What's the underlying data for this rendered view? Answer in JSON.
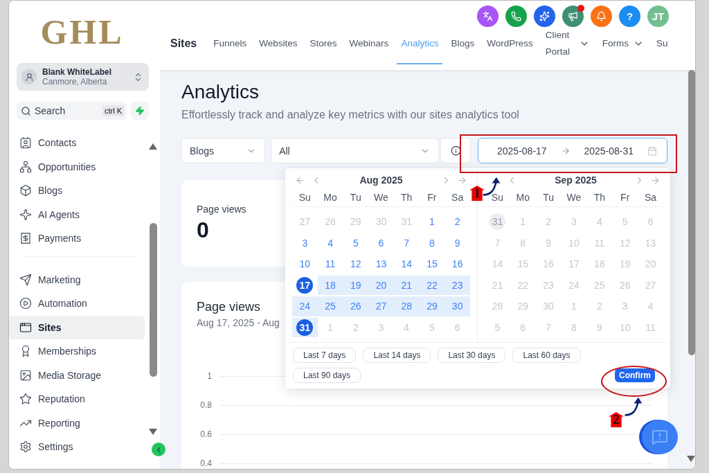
{
  "sidebar": {
    "logo": "GHL",
    "account": {
      "name": "Blank WhiteLabel",
      "location": "Canmore, Alberta"
    },
    "search": {
      "placeholder": "Search",
      "shortcut": "ctrl K"
    },
    "nav_groups": [
      [
        {
          "label": "Contacts",
          "selected": false
        },
        {
          "label": "Opportunities",
          "selected": false
        },
        {
          "label": "Blogs",
          "selected": false
        },
        {
          "label": "AI Agents",
          "selected": false
        },
        {
          "label": "Payments",
          "selected": false
        }
      ],
      [
        {
          "label": "Marketing",
          "selected": false
        },
        {
          "label": "Automation",
          "selected": false
        },
        {
          "label": "Sites",
          "selected": true
        },
        {
          "label": "Memberships",
          "selected": false
        },
        {
          "label": "Media Storage",
          "selected": false
        },
        {
          "label": "Reputation",
          "selected": false
        },
        {
          "label": "Reporting",
          "selected": false
        }
      ],
      [
        {
          "label": "Settings",
          "selected": false
        }
      ]
    ]
  },
  "header": {
    "actions": [
      {
        "kind": "translate",
        "color": "#a855f7",
        "badge": false
      },
      {
        "kind": "phone",
        "color": "#16a34a",
        "badge": false
      },
      {
        "kind": "sparkles",
        "color": "#2563eb",
        "badge": false
      },
      {
        "kind": "megaphone",
        "color": "#3f8f72",
        "badge": true
      },
      {
        "kind": "bell",
        "color": "#f97316",
        "badge": false
      },
      {
        "kind": "help",
        "label": "?",
        "color": "#1d8cf0",
        "badge": false
      },
      {
        "kind": "avatar",
        "label": "JT",
        "color": "#74bf92",
        "badge": false
      }
    ],
    "section": "Sites",
    "tabs": [
      {
        "label": "Funnels",
        "selected": false,
        "dropdown": false
      },
      {
        "label": "Websites",
        "selected": false,
        "dropdown": false
      },
      {
        "label": "Stores",
        "selected": false,
        "dropdown": false
      },
      {
        "label": "Webinars",
        "selected": false,
        "dropdown": false
      },
      {
        "label": "Analytics",
        "selected": true,
        "dropdown": false
      },
      {
        "label": "Blogs",
        "selected": false,
        "dropdown": false
      },
      {
        "label": "WordPress",
        "selected": false,
        "dropdown": false
      },
      {
        "label": "Client Portal",
        "selected": false,
        "dropdown": true
      },
      {
        "label": "Forms",
        "selected": false,
        "dropdown": true
      },
      {
        "label": "Su",
        "selected": false,
        "dropdown": false
      }
    ]
  },
  "page": {
    "title": "Analytics",
    "subtitle": "Effortlessly track and analyze key metrics with our sites analytics tool"
  },
  "filters": {
    "type_select": "Blogs",
    "item_select": "All",
    "date_start": "2025-08-17",
    "date_end": "2025-08-31"
  },
  "stat_card": {
    "label": "Page views",
    "value": "0"
  },
  "chart_card": {
    "title": "Page views",
    "subtitle": "Aug 17, 2025 - Aug",
    "y_ticks": [
      "1",
      "0.8",
      "0.6",
      "0.4"
    ]
  },
  "date_picker": {
    "months": [
      {
        "title": "Aug 2025",
        "weekdays": [
          "Su",
          "Mo",
          "Tu",
          "We",
          "Th",
          "Fr",
          "Sa"
        ],
        "weeks": [
          [
            {
              "label": "27",
              "kind": "other"
            },
            {
              "label": "28",
              "kind": "other"
            },
            {
              "label": "29",
              "kind": "other"
            },
            {
              "label": "30",
              "kind": "other"
            },
            {
              "label": "31",
              "kind": "other"
            },
            {
              "label": "1",
              "kind": "day"
            },
            {
              "label": "2",
              "kind": "day"
            }
          ],
          [
            {
              "label": "3",
              "kind": "day"
            },
            {
              "label": "4",
              "kind": "day"
            },
            {
              "label": "5",
              "kind": "day"
            },
            {
              "label": "6",
              "kind": "day"
            },
            {
              "label": "7",
              "kind": "day"
            },
            {
              "label": "8",
              "kind": "day"
            },
            {
              "label": "9",
              "kind": "day"
            }
          ],
          [
            {
              "label": "10",
              "kind": "day"
            },
            {
              "label": "11",
              "kind": "day"
            },
            {
              "label": "12",
              "kind": "day"
            },
            {
              "label": "13",
              "kind": "day"
            },
            {
              "label": "14",
              "kind": "day"
            },
            {
              "label": "15",
              "kind": "day"
            },
            {
              "label": "16",
              "kind": "day"
            }
          ],
          [
            {
              "label": "17",
              "kind": "endpoint"
            },
            {
              "label": "18",
              "kind": "range"
            },
            {
              "label": "19",
              "kind": "range"
            },
            {
              "label": "20",
              "kind": "range"
            },
            {
              "label": "21",
              "kind": "range"
            },
            {
              "label": "22",
              "kind": "range"
            },
            {
              "label": "23",
              "kind": "range"
            }
          ],
          [
            {
              "label": "24",
              "kind": "range"
            },
            {
              "label": "25",
              "kind": "range"
            },
            {
              "label": "26",
              "kind": "range"
            },
            {
              "label": "27",
              "kind": "range"
            },
            {
              "label": "28",
              "kind": "range"
            },
            {
              "label": "29",
              "kind": "range"
            },
            {
              "label": "30",
              "kind": "range"
            }
          ],
          [
            {
              "label": "31",
              "kind": "endpoint"
            },
            {
              "label": "1",
              "kind": "other"
            },
            {
              "label": "2",
              "kind": "other"
            },
            {
              "label": "3",
              "kind": "other"
            },
            {
              "label": "4",
              "kind": "other"
            },
            {
              "label": "5",
              "kind": "other"
            },
            {
              "label": "6",
              "kind": "other"
            }
          ]
        ]
      },
      {
        "title": "Sep 2025",
        "weekdays": [
          "Su",
          "Mo",
          "Tu",
          "We",
          "Th",
          "Fr",
          "Sa"
        ],
        "weeks": [
          [
            {
              "label": "31",
              "kind": "marked"
            },
            {
              "label": "1",
              "kind": "other"
            },
            {
              "label": "2",
              "kind": "other"
            },
            {
              "label": "3",
              "kind": "other"
            },
            {
              "label": "4",
              "kind": "other"
            },
            {
              "label": "5",
              "kind": "other"
            },
            {
              "label": "6",
              "kind": "other"
            }
          ],
          [
            {
              "label": "7",
              "kind": "other"
            },
            {
              "label": "8",
              "kind": "other"
            },
            {
              "label": "9",
              "kind": "other"
            },
            {
              "label": "10",
              "kind": "other"
            },
            {
              "label": "11",
              "kind": "other"
            },
            {
              "label": "12",
              "kind": "other"
            },
            {
              "label": "13",
              "kind": "other"
            }
          ],
          [
            {
              "label": "14",
              "kind": "other"
            },
            {
              "label": "15",
              "kind": "other"
            },
            {
              "label": "16",
              "kind": "other"
            },
            {
              "label": "17",
              "kind": "other"
            },
            {
              "label": "18",
              "kind": "other"
            },
            {
              "label": "19",
              "kind": "other"
            },
            {
              "label": "20",
              "kind": "other"
            }
          ],
          [
            {
              "label": "21",
              "kind": "other"
            },
            {
              "label": "22",
              "kind": "other"
            },
            {
              "label": "23",
              "kind": "other"
            },
            {
              "label": "24",
              "kind": "other"
            },
            {
              "label": "25",
              "kind": "other"
            },
            {
              "label": "26",
              "kind": "other"
            },
            {
              "label": "27",
              "kind": "other"
            }
          ],
          [
            {
              "label": "28",
              "kind": "other"
            },
            {
              "label": "29",
              "kind": "other"
            },
            {
              "label": "30",
              "kind": "other"
            },
            {
              "label": "1",
              "kind": "other"
            },
            {
              "label": "2",
              "kind": "other"
            },
            {
              "label": "3",
              "kind": "other"
            },
            {
              "label": "4",
              "kind": "other"
            }
          ],
          [
            {
              "label": "5",
              "kind": "other"
            },
            {
              "label": "6",
              "kind": "other"
            },
            {
              "label": "7",
              "kind": "other"
            },
            {
              "label": "8",
              "kind": "other"
            },
            {
              "label": "9",
              "kind": "other"
            },
            {
              "label": "10",
              "kind": "other"
            },
            {
              "label": "11",
              "kind": "other"
            }
          ]
        ]
      }
    ],
    "presets": [
      "Last 7 days",
      "Last 14 days",
      "Last 30 days",
      "Last 60 days",
      "Last 90 days"
    ],
    "confirm": "Confirm"
  },
  "annotations": [
    {
      "label": "1"
    },
    {
      "label": "2"
    }
  ]
}
